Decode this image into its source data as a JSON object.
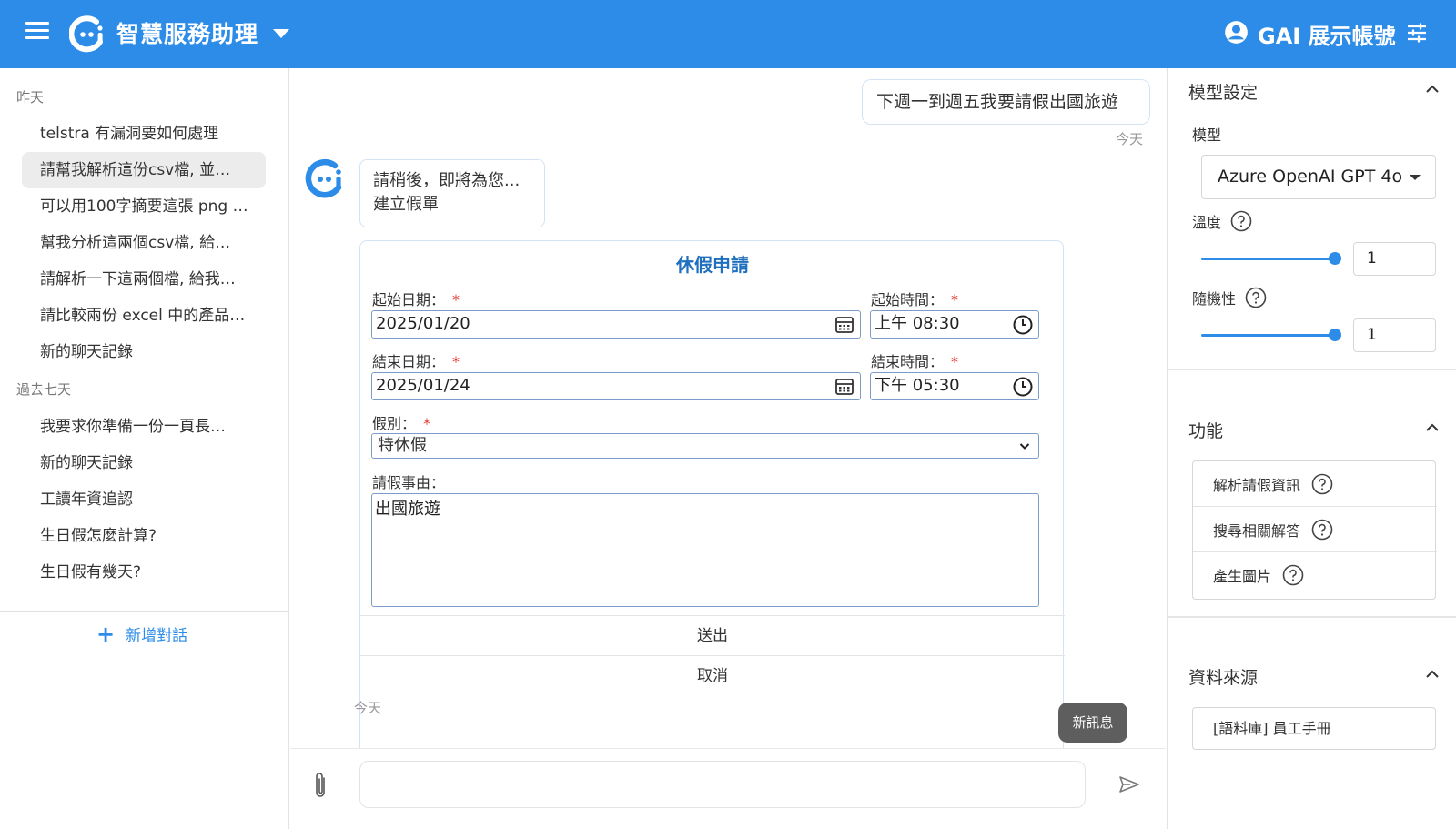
{
  "header": {
    "app_title": "智慧服務助理",
    "account_name": "GAI 展示帳號",
    "brand_color": "#2c8ce8"
  },
  "sidebar": {
    "sections": [
      {
        "label": "昨天",
        "items": [
          "telstra 有漏洞要如何處理",
          "請幫我解析這份csv檔, 並…",
          "可以用100字摘要這張 png …",
          "幫我分析這兩個csv檔, 給…",
          "請解析一下這兩個檔, 給我…",
          "請比較兩份 excel 中的產品…",
          "新的聊天記錄"
        ]
      },
      {
        "label": "過去七天",
        "items": [
          "我要求你準備一份一頁長…",
          "新的聊天記錄",
          "工讀年資追認",
          "生日假怎麼計算?",
          "生日假有幾天?"
        ]
      }
    ],
    "active_item": "請幫我解析這份csv檔, 並…",
    "new_chat_label": "新增對話"
  },
  "chat": {
    "user_message": "下週一到週五我要請假出國旅遊",
    "user_time": "今天",
    "bot_message_line1": "請稍後，即將為您...",
    "bot_message_line2": "建立假單",
    "bot_time": "今天",
    "form": {
      "title": "休假申請",
      "start_date_label": "起始日期：",
      "start_date": "2025/01/20",
      "start_time_label": "起始時間：",
      "start_time": "上午 08:30",
      "end_date_label": "結束日期：",
      "end_date": "2025/01/24",
      "end_time_label": "結束時間：",
      "end_time": "下午 05:30",
      "leave_type_label": "假別：",
      "leave_type": "特休假",
      "reason_label": "請假事由：",
      "reason": "出國旅遊",
      "required_mark": "*",
      "submit_label": "送出",
      "cancel_label": "取消"
    },
    "new_message_label": "新訊息",
    "input_placeholder": ""
  },
  "right_panel": {
    "model_settings": {
      "title": "模型設定",
      "model_label": "模型",
      "model_value": "Azure OpenAI GPT 4o",
      "temperature_label": "溫度",
      "temperature_value": "1",
      "temperature_level": 1,
      "randomness_label": "隨機性",
      "randomness_value": "1",
      "randomness_level": 1
    },
    "features": {
      "title": "功能",
      "items": [
        "解析請假資訊",
        "搜尋相關解答",
        "產生圖片"
      ]
    },
    "data_sources": {
      "title": "資料來源",
      "items": [
        "[語料庫] 員工手冊"
      ]
    }
  }
}
